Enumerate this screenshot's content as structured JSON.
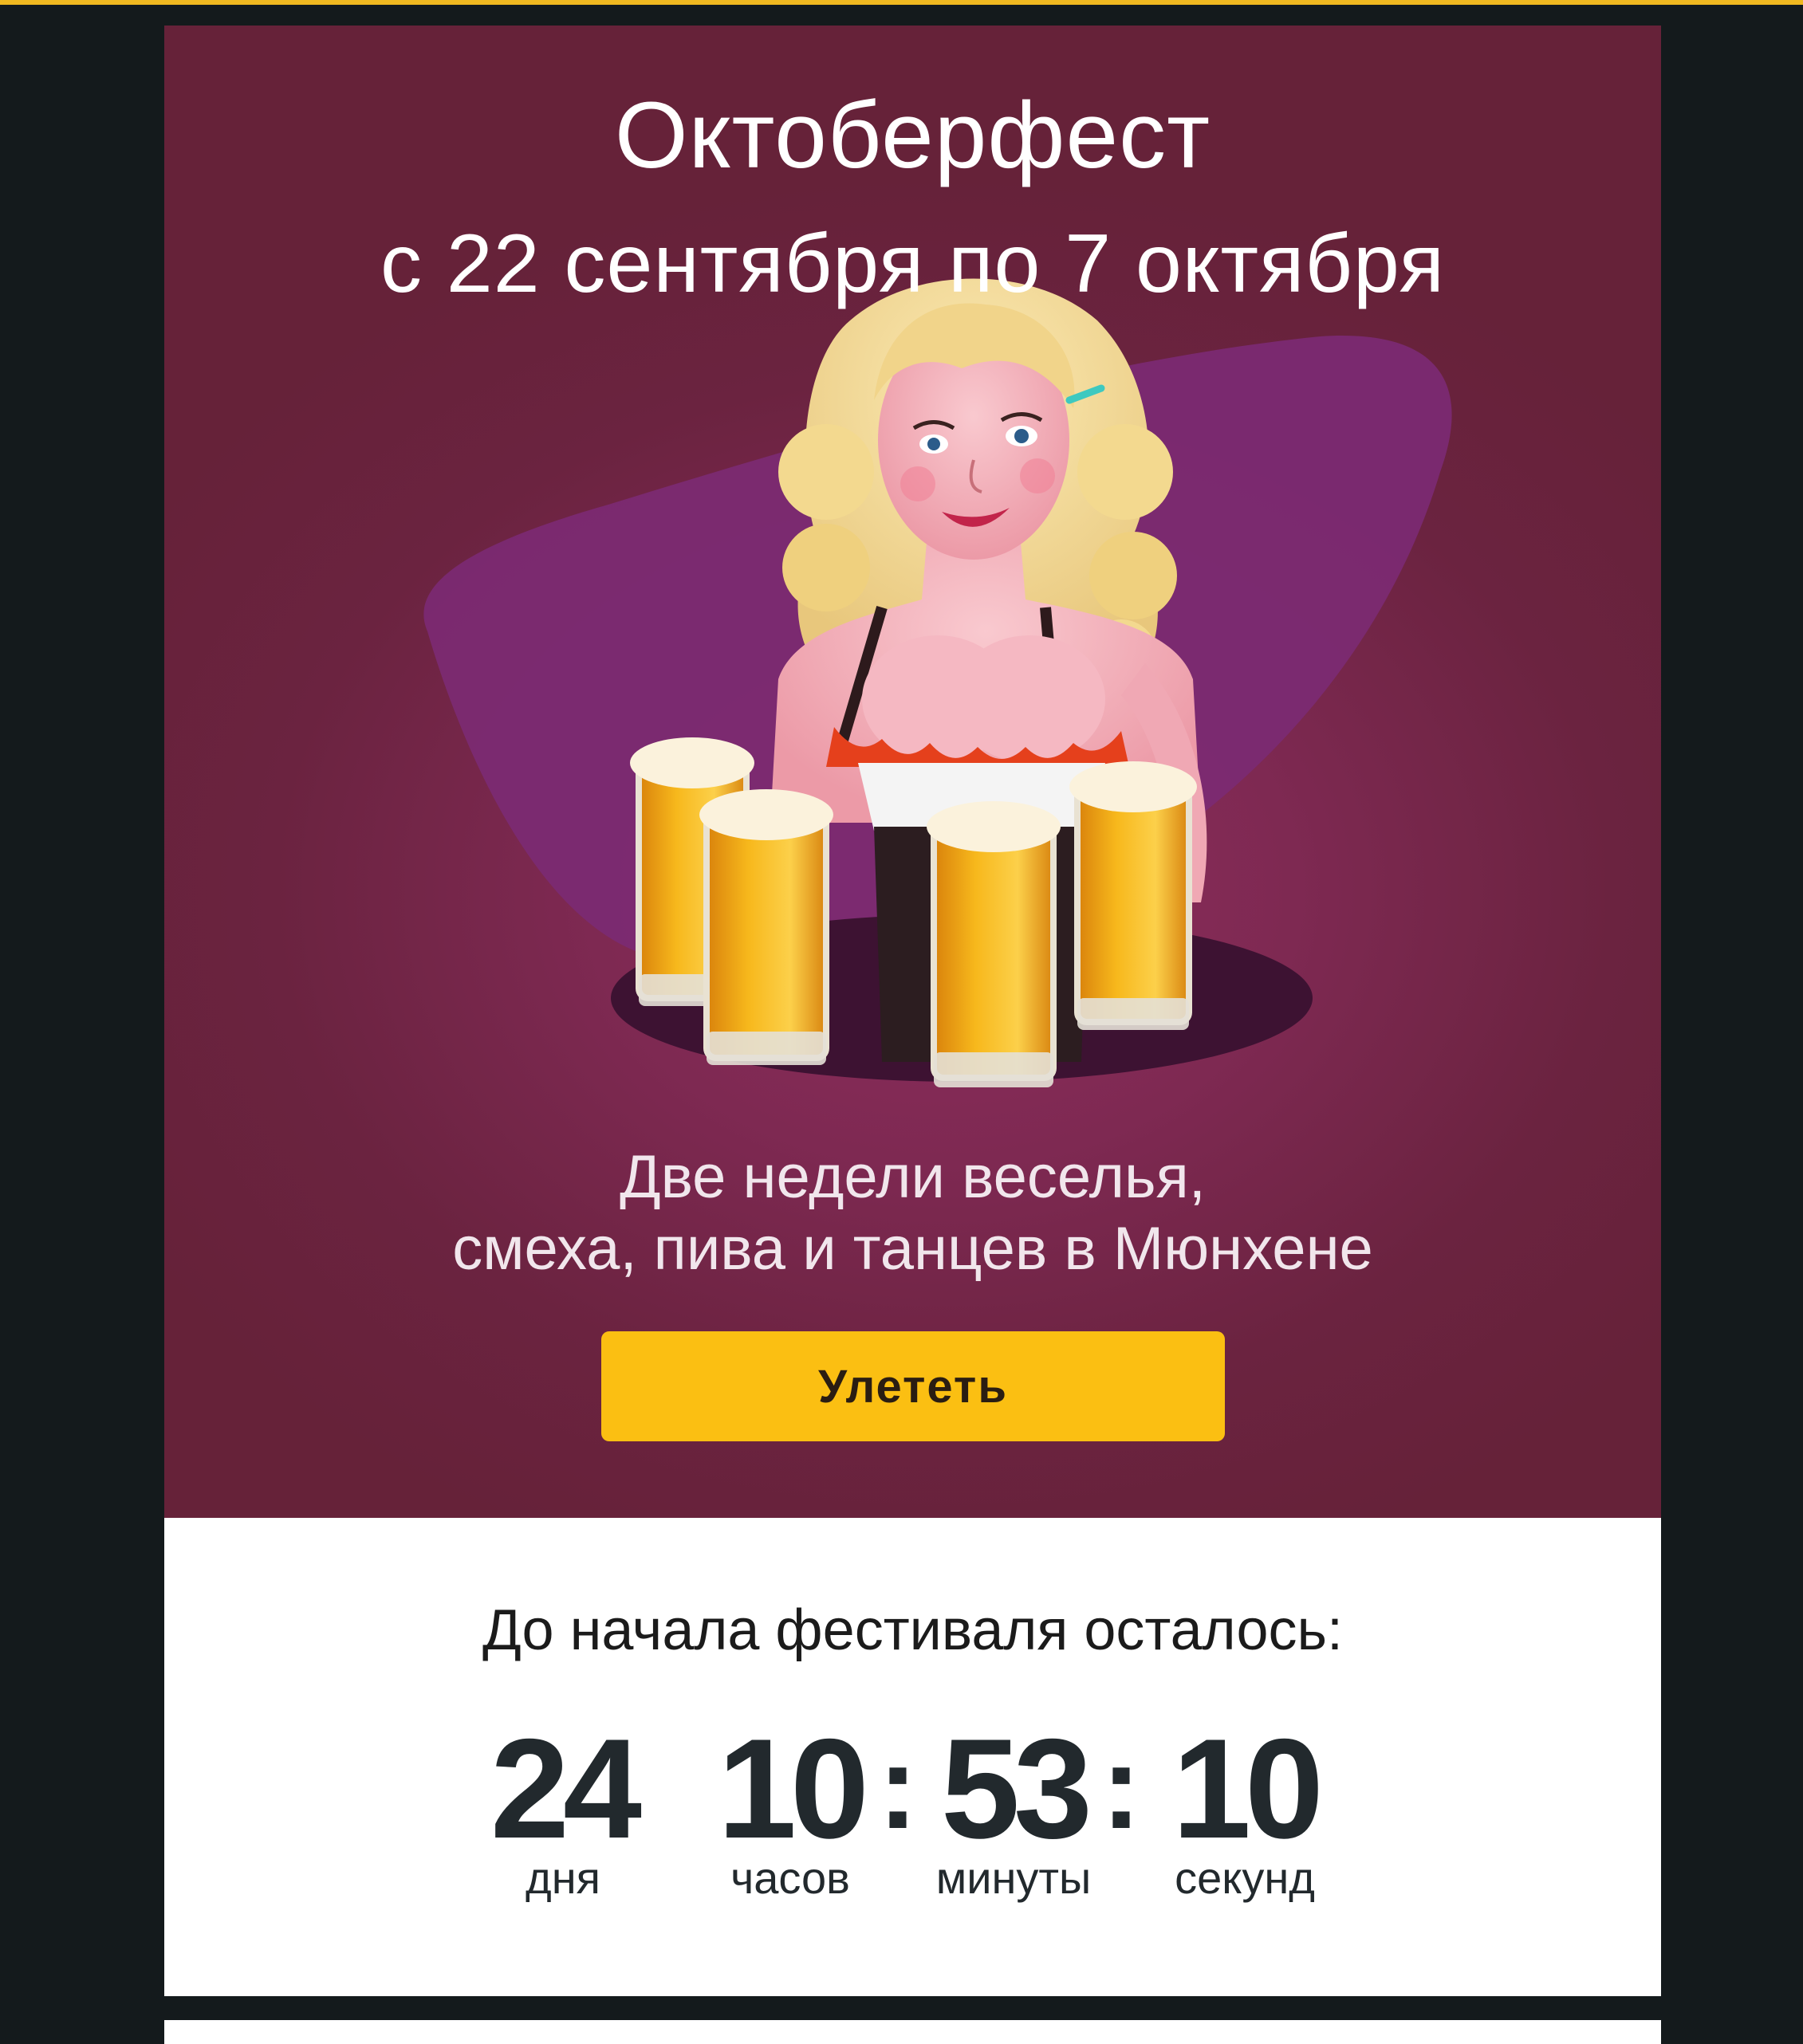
{
  "banner": {
    "title": "Октоберфест",
    "dates": "с 22 сентября по 7 октября",
    "tagline_line1": "Две недели веселья,",
    "tagline_line2": "смеха, пива и танцев в Мюнхене",
    "cta_label": "Улететь",
    "colors": {
      "background": "#6b2340",
      "accent_shape": "#7a2a73",
      "button": "#fbbf12"
    }
  },
  "countdown": {
    "heading": "До начала фестиваля осталось:",
    "days": "24",
    "days_label": "дня",
    "hours": "10",
    "hours_label": "часов",
    "minutes": "53",
    "minutes_label": "минуты",
    "seconds": "10",
    "seconds_label": "секунд",
    "separator": ":"
  }
}
